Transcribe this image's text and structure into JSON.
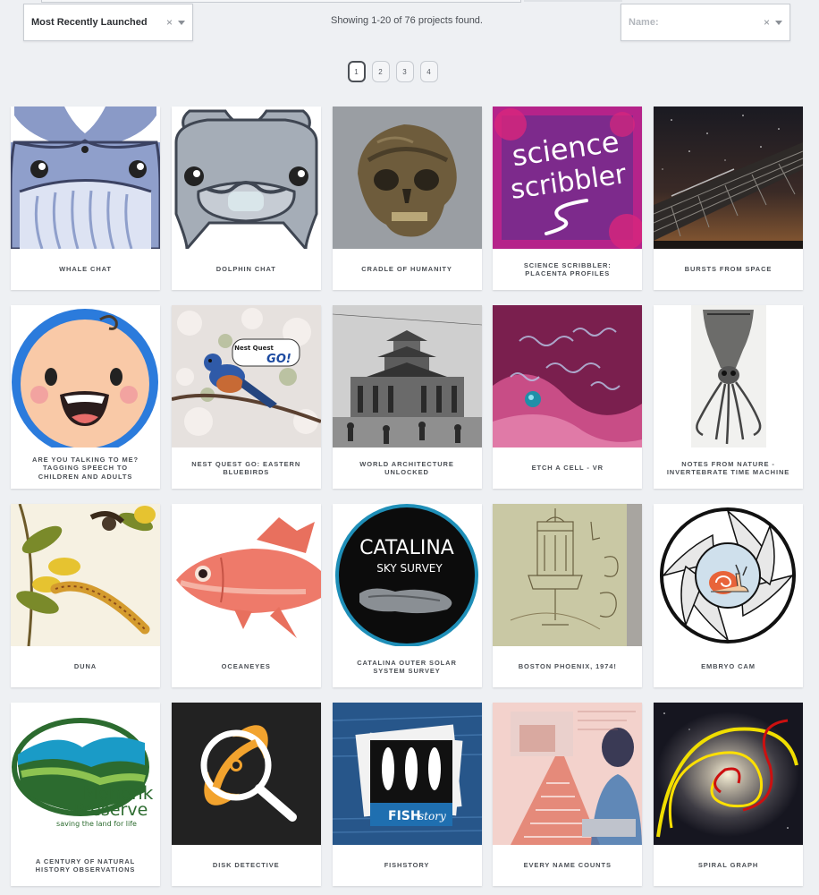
{
  "filters": {
    "sort_value": "Most Recently Launched",
    "name_placeholder": "Name:",
    "clear_glyph": "×"
  },
  "results": {
    "count_text": "Showing 1-20 of 76 projects found."
  },
  "pagination": {
    "pages": [
      "1",
      "2",
      "3",
      "4"
    ],
    "current": "1"
  },
  "projects": [
    {
      "title": "WHALE CHAT",
      "icon": "whale-icon"
    },
    {
      "title": "DOLPHIN CHAT",
      "icon": "dolphin-icon"
    },
    {
      "title": "CRADLE OF HUMANITY",
      "icon": "skull-photo"
    },
    {
      "title": "SCIENCE SCRIBBLER: PLACENTA PROFILES",
      "icon": "science-scribbler-logo",
      "logo_line1": "science",
      "logo_line2": "scribbler"
    },
    {
      "title": "BURSTS FROM SPACE",
      "icon": "radio-telescope-photo"
    },
    {
      "title": "ARE YOU TALKING TO ME? TAGGING SPEECH TO CHILDREN AND ADULTS",
      "icon": "baby-face-icon"
    },
    {
      "title": "NEST QUEST GO: EASTERN BLUEBIRDS",
      "icon": "bluebird-photo",
      "badge_line1": "Nest Quest",
      "badge_line2": "GO!"
    },
    {
      "title": "WORLD ARCHITECTURE UNLOCKED",
      "icon": "pagoda-photo"
    },
    {
      "title": "ETCH A CELL - VR",
      "icon": "cell-render"
    },
    {
      "title": "NOTES FROM NATURE - INVERTEBRATE TIME MACHINE",
      "icon": "squid-illustration"
    },
    {
      "title": "DUNA",
      "icon": "caterpillar-illustration"
    },
    {
      "title": "OCEANEYES",
      "icon": "red-fish-illustration"
    },
    {
      "title": "CATALINA OUTER SOLAR SYSTEM SURVEY",
      "icon": "catalina-logo",
      "logo_line1": "CATALINA",
      "logo_line2": "SKY SURVEY"
    },
    {
      "title": "BOSTON PHOENIX, 1974!",
      "icon": "lamp-illustration"
    },
    {
      "title": "EMBRYO CAM",
      "icon": "snail-camera-icon"
    },
    {
      "title": "A CENTURY OF NATURAL HISTORY OBSERVATIONS",
      "icon": "mohonk-logo",
      "logo_line1": "Mohonk",
      "logo_line2": "Preserve",
      "logo_line3": "saving the land for life"
    },
    {
      "title": "DISK DETECTIVE",
      "icon": "magnifier-disk-icon"
    },
    {
      "title": "FISHSTORY",
      "icon": "fishstory-logo",
      "logo_line1": "FISH",
      "logo_line2": "story"
    },
    {
      "title": "EVERY NAME COUNTS",
      "icon": "archive-collage"
    },
    {
      "title": "SPIRAL GRAPH",
      "icon": "galaxy-photo"
    }
  ],
  "colors": {
    "page_bg": "#eef0f3",
    "card_bg": "#ffffff",
    "label_text": "#4b4f55"
  }
}
